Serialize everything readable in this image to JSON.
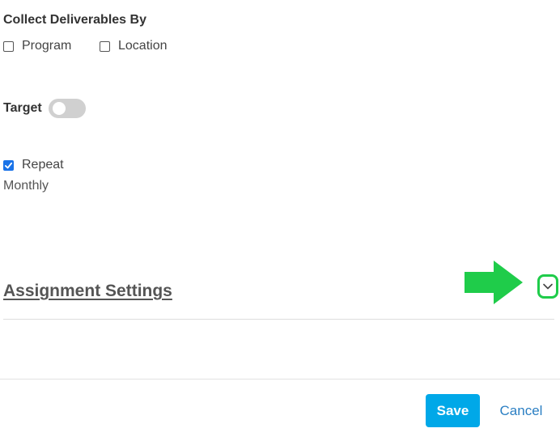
{
  "collect": {
    "title": "Collect Deliverables By",
    "options": [
      {
        "label": "Program",
        "checked": false
      },
      {
        "label": "Location",
        "checked": false
      }
    ]
  },
  "target": {
    "label": "Target",
    "enabled": false
  },
  "repeat": {
    "label": "Repeat",
    "checked": true,
    "frequency": "Monthly"
  },
  "assignment": {
    "title": "Assignment Settings",
    "expand_icon": "chevron-down-icon"
  },
  "annotation": {
    "arrow_icon": "arrow-right-icon",
    "highlight_color": "#1fcc4a"
  },
  "footer": {
    "save_label": "Save",
    "cancel_label": "Cancel"
  },
  "colors": {
    "primary_button": "#00a8e8",
    "link": "#2b7fc3",
    "checkbox_checked": "#1a73e8",
    "toggle_off": "#d0d0d0"
  }
}
